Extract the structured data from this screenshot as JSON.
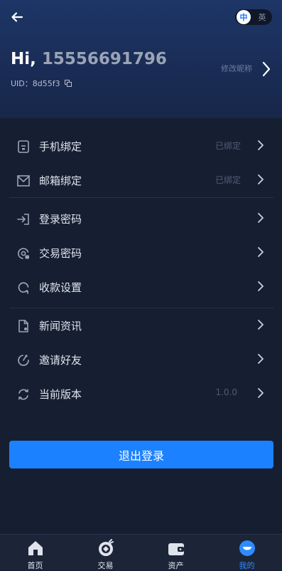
{
  "header": {
    "greeting_hi": "Hi,",
    "phone": "15556691796",
    "uid_label": "UID：8d55f3",
    "edit_nickname": "修改昵称",
    "lang_zh": "中",
    "lang_en": "英"
  },
  "menu": {
    "phone_bind": {
      "label": "手机绑定",
      "status": "已绑定",
      "icon": "phone-icon"
    },
    "email_bind": {
      "label": "邮箱绑定",
      "status": "已绑定",
      "icon": "mail-icon"
    },
    "login_password": {
      "label": "登录密码",
      "icon": "login-icon"
    },
    "trade_password": {
      "label": "交易密码",
      "icon": "lock-badge-icon"
    },
    "payment_settings": {
      "label": "收款设置",
      "icon": "refresh-icon"
    },
    "news": {
      "label": "新闻资讯",
      "icon": "document-icon"
    },
    "invite_friends": {
      "label": "邀请好友",
      "icon": "share-icon"
    },
    "current_version": {
      "label": "当前版本",
      "status": "1.0.0",
      "icon": "sync-icon"
    }
  },
  "logout_label": "退出登录",
  "tabs": [
    {
      "label": "首页",
      "icon": "home-icon"
    },
    {
      "label": "交易",
      "icon": "trade-icon"
    },
    {
      "label": "资产",
      "icon": "wallet-icon"
    },
    {
      "label": "我的",
      "icon": "profile-icon",
      "active": true
    }
  ],
  "colors": {
    "background": "#161e31",
    "header": "#1d3667",
    "accent": "#1c81ff",
    "tab_active": "#2e8bff"
  }
}
